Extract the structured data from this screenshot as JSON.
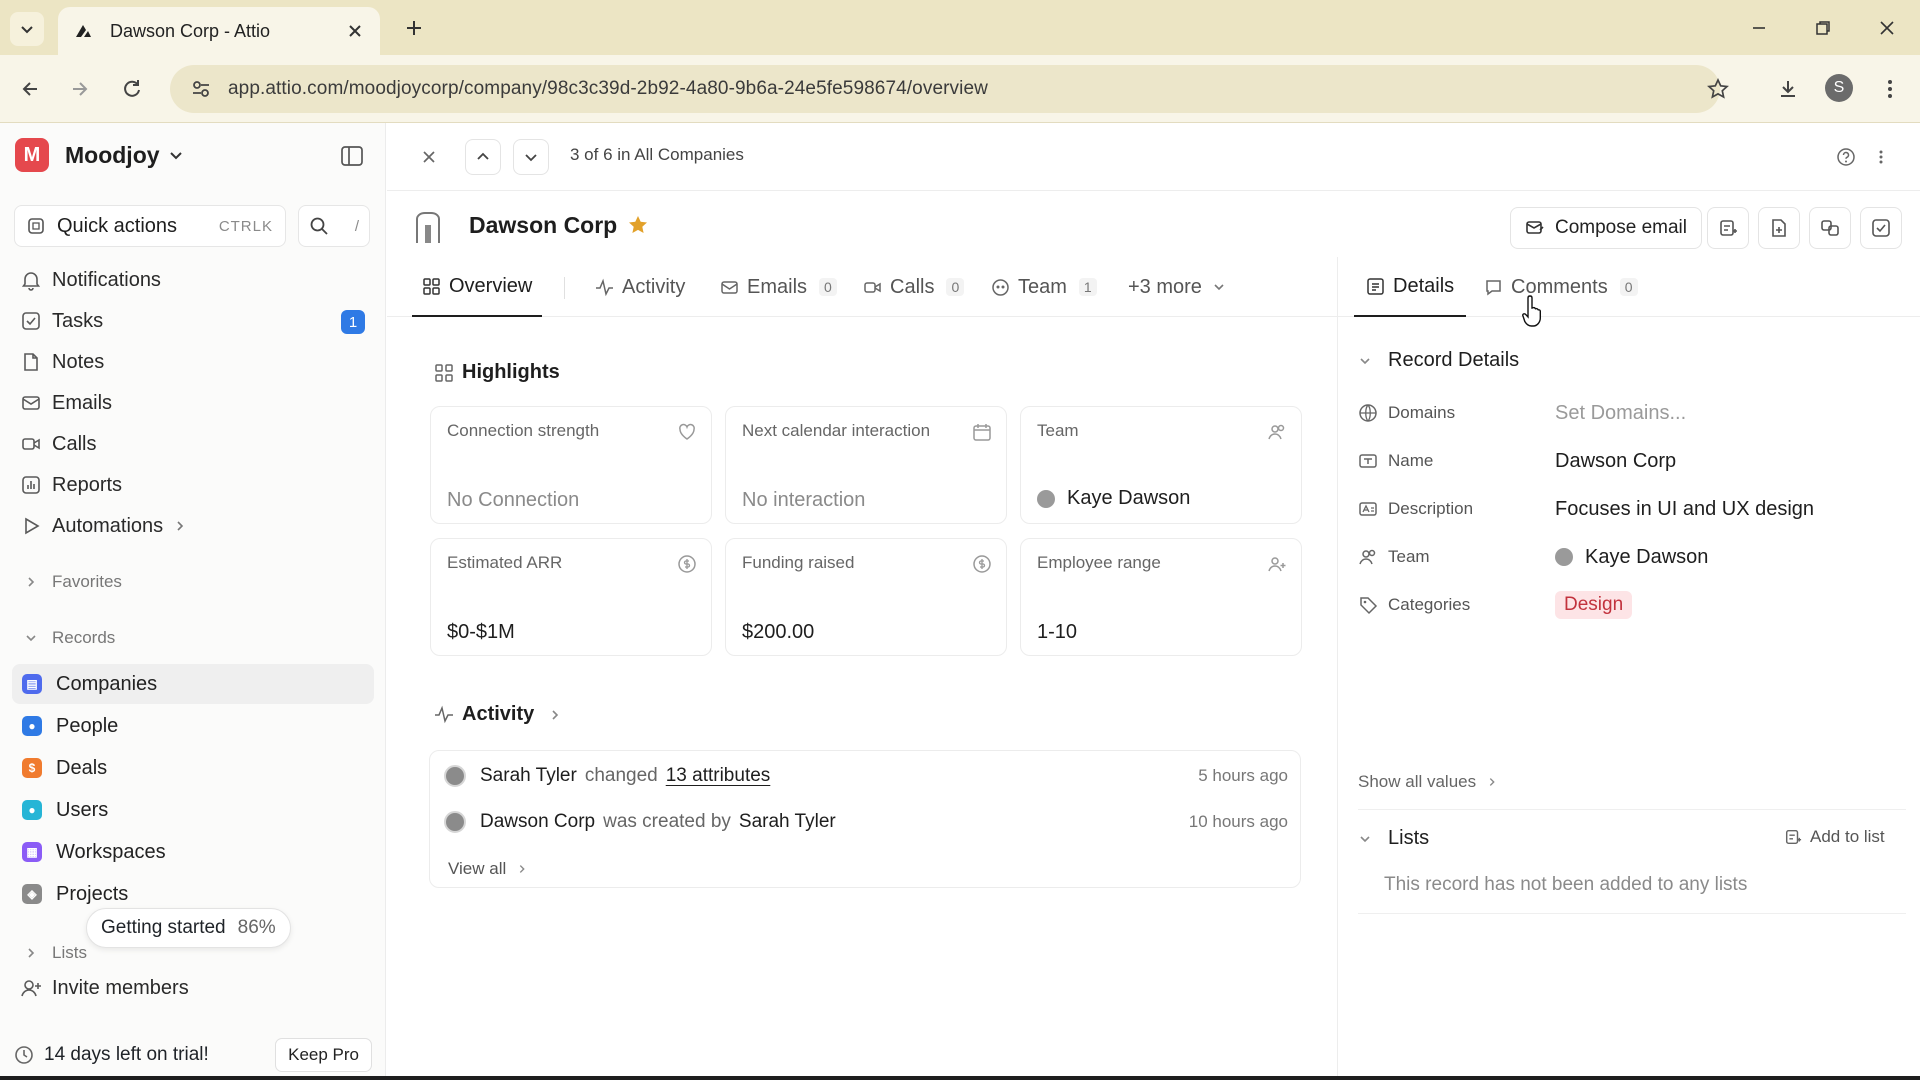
{
  "browser": {
    "tab_title": "Dawson Corp - Attio",
    "url": "app.attio.com/moodjoycorp/company/98c3c39d-2b92-4a80-9b6a-24e5fe598674/overview",
    "profile_initial": "S"
  },
  "sidebar": {
    "workspace_initial": "M",
    "workspace_name": "Moodjoy",
    "quick_actions": {
      "label": "Quick actions",
      "shortcut": "CTRLK",
      "search_shortcut": "/"
    },
    "nav": [
      {
        "label": "Notifications",
        "icon": "bell-icon"
      },
      {
        "label": "Tasks",
        "icon": "check-square-icon",
        "badge": "1"
      },
      {
        "label": "Notes",
        "icon": "note-icon"
      },
      {
        "label": "Emails",
        "icon": "mail-icon"
      },
      {
        "label": "Calls",
        "icon": "video-icon"
      },
      {
        "label": "Reports",
        "icon": "chart-icon"
      },
      {
        "label": "Automations",
        "icon": "play-icon"
      }
    ],
    "favorites_label": "Favorites",
    "records_label": "Records",
    "records": [
      {
        "label": "Companies",
        "color": "#4f6bed",
        "active": true
      },
      {
        "label": "People",
        "color": "#2f7ae5"
      },
      {
        "label": "Deals",
        "color": "#f07b2e"
      },
      {
        "label": "Users",
        "color": "#26b5d6"
      },
      {
        "label": "Workspaces",
        "color": "#8b5cf6"
      },
      {
        "label": "Projects",
        "color": "#8a8a8a"
      }
    ],
    "lists_label": "Lists",
    "invite_label": "Invite members",
    "getting_started": {
      "label": "Getting started",
      "percent": "86%"
    },
    "trial": {
      "label": "14 days left on trial!",
      "button": "Keep Pro"
    }
  },
  "topnav": {
    "position_text": "3 of 6 in All Companies"
  },
  "record": {
    "name": "Dawson Corp",
    "compose_label": "Compose email"
  },
  "tabs": [
    {
      "label": "Overview",
      "active": true
    },
    {
      "label": "Activity"
    },
    {
      "label": "Emails",
      "count": "0"
    },
    {
      "label": "Calls",
      "count": "0"
    },
    {
      "label": "Team",
      "count": "1"
    },
    {
      "label": "+3 more"
    }
  ],
  "highlights": {
    "title": "Highlights",
    "cards": [
      {
        "label": "Connection strength",
        "value": "No Connection",
        "muted": true,
        "icon": "heart-icon"
      },
      {
        "label": "Next calendar interaction",
        "value": "No interaction",
        "muted": true,
        "icon": "calendar-icon"
      },
      {
        "label": "Team",
        "value": "Kaye Dawson",
        "person": true,
        "icon": "users-icon"
      },
      {
        "label": "Estimated ARR",
        "value": "$0-$1M",
        "icon": "dollar-up-icon"
      },
      {
        "label": "Funding raised",
        "value": "$200.00",
        "icon": "dollar-icon"
      },
      {
        "label": "Employee range",
        "value": "1-10",
        "icon": "user-plus-icon"
      }
    ]
  },
  "activity": {
    "title": "Activity",
    "items": [
      {
        "actor": "Sarah Tyler",
        "verb": "changed",
        "object": "13 attributes",
        "time": "5 hours ago"
      },
      {
        "actor": "Dawson Corp",
        "verb": "was created by",
        "object": "Sarah Tyler",
        "time": "10 hours ago"
      }
    ],
    "view_all": "View all"
  },
  "right_panel": {
    "tabs": [
      {
        "label": "Details",
        "active": true
      },
      {
        "label": "Comments",
        "count": "0"
      }
    ],
    "record_details_title": "Record Details",
    "attributes": [
      {
        "key": "Domains",
        "value": "Set Domains...",
        "placeholder": true
      },
      {
        "key": "Name",
        "value": "Dawson Corp"
      },
      {
        "key": "Description",
        "value": "Focuses in UI and UX design"
      },
      {
        "key": "Team",
        "value": "Kaye Dawson",
        "person": true
      },
      {
        "key": "Categories",
        "value": "Design",
        "chip": true
      }
    ],
    "show_all": "Show all values",
    "lists_title": "Lists",
    "add_to_list": "Add to list",
    "no_lists": "This record has not been added to any lists"
  }
}
